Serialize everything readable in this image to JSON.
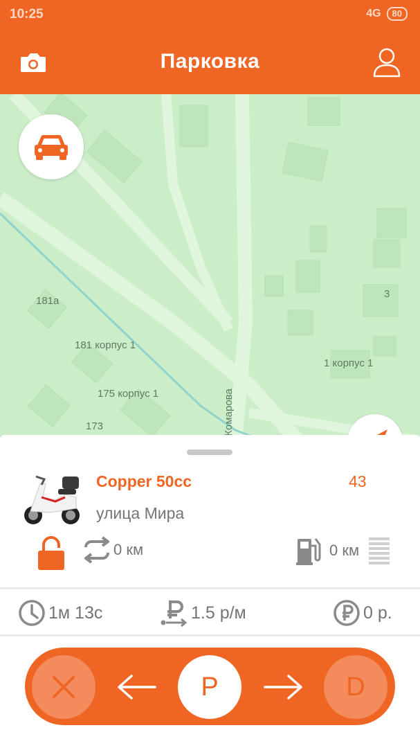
{
  "status_bar": {
    "time": "10:25",
    "network": "4G",
    "battery": "80"
  },
  "header": {
    "title": "Парковка",
    "camera_icon": "camera-icon",
    "profile_icon": "user-icon"
  },
  "map": {
    "street_name": "ул. Комарова",
    "labels": [
      "181а",
      "181 корпус 1",
      "175 корпус 1",
      "173",
      "1 корпус 1",
      "3"
    ],
    "car_button_icon": "car-icon",
    "locate_button_icon": "navigation-arrow-icon"
  },
  "vehicle": {
    "name": "Copper 50cc",
    "number": "43",
    "address": "улица Мира",
    "lock_icon": "lock-open-icon",
    "distance": "0 км",
    "distance_icon": "route-arrows-icon",
    "fuel_range": "0 км",
    "fuel_icon": "fuel-pump-icon",
    "fuel_level_icon": "fuel-level-bars-icon"
  },
  "stats": {
    "duration": "1м 13с",
    "rate": "1.5 р/м",
    "cost": "0 р.",
    "clock_icon": "clock-icon",
    "rate_icon": "ruble-rate-icon",
    "cost_icon": "ruble-coin-icon"
  },
  "controls": {
    "cancel_icon": "close-icon",
    "park_label": "P",
    "drive_label": "D",
    "left_icon": "arrow-left-icon",
    "right_icon": "arrow-right-icon"
  },
  "colors": {
    "accent": "#ef6524",
    "accent_light": "#f48b5c",
    "map_bg": "#cbedc8"
  }
}
